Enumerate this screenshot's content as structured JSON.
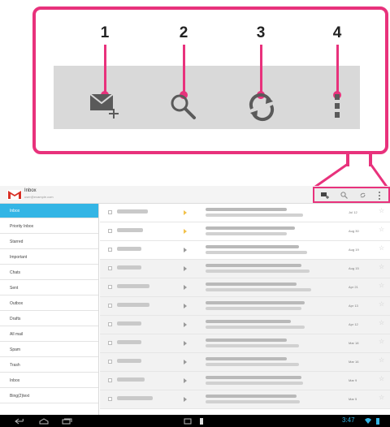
{
  "callout": {
    "items": [
      {
        "number": "1",
        "icon": "compose-icon"
      },
      {
        "number": "2",
        "icon": "search-icon"
      },
      {
        "number": "3",
        "icon": "refresh-icon"
      },
      {
        "number": "4",
        "icon": "overflow-menu-icon"
      }
    ]
  },
  "colors": {
    "callout_accent": "#e8327c",
    "selected_nav": "#33b5e5",
    "action_bar_zoom": "#d9d9d9"
  },
  "appbar": {
    "title": "Inbox",
    "account": "user@example.com",
    "icon": "gmail-logo-icon",
    "actions": [
      "compose-icon",
      "search-icon",
      "refresh-icon",
      "overflow-menu-icon"
    ]
  },
  "sidebar": {
    "items": [
      {
        "label": "Inbox",
        "active": true
      },
      {
        "label": "Priority Inbox"
      },
      {
        "label": "Starred"
      },
      {
        "label": "Important"
      },
      {
        "label": "Chats"
      },
      {
        "label": "Sent"
      },
      {
        "label": "Outbox"
      },
      {
        "label": "Drafts"
      },
      {
        "label": "All mail"
      },
      {
        "label": "Spam"
      },
      {
        "label": "Trash"
      },
      {
        "label": "Inbox"
      },
      {
        "label": "Bing(2)text"
      }
    ]
  },
  "messages": [
    {
      "date": "Jul 12",
      "important": true,
      "read": false
    },
    {
      "date": "Aug 30",
      "important": true,
      "read": false
    },
    {
      "date": "Aug 19",
      "important": false,
      "read": false
    },
    {
      "date": "Aug 15",
      "important": false,
      "read": true
    },
    {
      "date": "Apr 21",
      "important": false,
      "read": true
    },
    {
      "date": "Apr 13",
      "important": false,
      "read": true
    },
    {
      "date": "Apr 12",
      "important": false,
      "read": true
    },
    {
      "date": "Mar 18",
      "important": false,
      "read": true
    },
    {
      "date": "Mar 16",
      "important": false,
      "read": true
    },
    {
      "date": "Mar 9",
      "important": false,
      "read": true
    },
    {
      "date": "Mar 5",
      "important": false,
      "read": true
    }
  ],
  "status": {
    "time": "3:47"
  },
  "navbar": {
    "buttons": [
      "back-icon",
      "home-icon",
      "recent-apps-icon"
    ]
  }
}
